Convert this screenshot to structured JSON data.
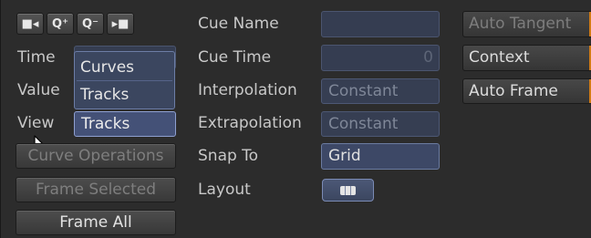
{
  "toolbar": {
    "buttons": [
      {
        "icon": "fit-to-left-icon",
        "glyph": "■◂"
      },
      {
        "icon": "zoom-in-icon",
        "glyph": "Q⁺"
      },
      {
        "icon": "zoom-out-icon",
        "glyph": "Q⁻"
      },
      {
        "icon": "fit-to-right-icon",
        "glyph": "▸■"
      }
    ]
  },
  "left": {
    "time_label": "Time",
    "value_label": "Value",
    "view_label": "View",
    "view_selected": "Tracks",
    "view_options": [
      "Curves",
      "Tracks"
    ],
    "curve_operations": "Curve Operations",
    "frame_selected": "Frame Selected",
    "frame_all": "Frame All"
  },
  "middle": {
    "cue_name_label": "Cue Name",
    "cue_name_value": "",
    "cue_time_label": "Cue Time",
    "cue_time_value": "0",
    "interpolation_label": "Interpolation",
    "interpolation_value": "Constant",
    "extrapolation_label": "Extrapolation",
    "extrapolation_value": "Constant",
    "snap_to_label": "Snap To",
    "snap_to_value": "Grid",
    "layout_label": "Layout"
  },
  "right": {
    "auto_tangent": "Auto Tangent",
    "context": "Context",
    "auto_frame": "Auto Frame"
  },
  "colors": {
    "accent_orange": "#d07a14",
    "field_blue": "#3a4358"
  }
}
